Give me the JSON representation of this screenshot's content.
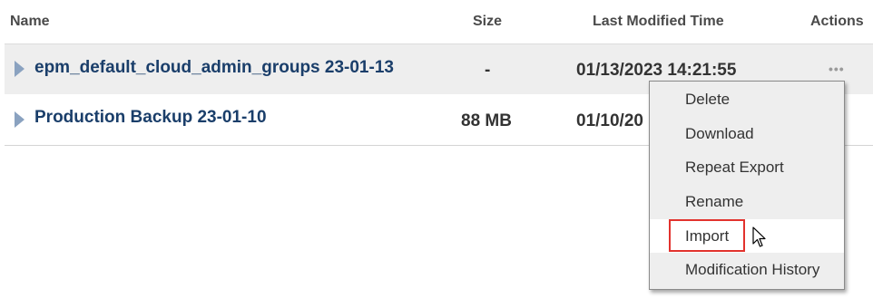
{
  "table": {
    "headers": {
      "name": "Name",
      "size": "Size",
      "modified": "Last Modified Time",
      "actions": "Actions"
    },
    "rows": [
      {
        "name": "epm_default_cloud_admin_groups 23-01-13",
        "size": "-",
        "modified": "01/13/2023 14:21:55",
        "actions_icon": "more-horizontal-icon"
      },
      {
        "name": "Production Backup 23-01-10",
        "size": "88 MB",
        "modified": "01/10/20",
        "actions_icon": "more-horizontal-icon"
      }
    ]
  },
  "context_menu": {
    "items": [
      "Delete",
      "Download",
      "Repeat Export",
      "Rename",
      "Import",
      "Modification History"
    ],
    "highlighted": "Import"
  },
  "icons": {
    "expander": "expand-triangle-icon",
    "cursor": "mouse-pointer-icon"
  },
  "colors": {
    "row_highlight": "#eeeeee",
    "link_text": "#1a3e6a",
    "highlight_box": "#e2322d",
    "expander": "#8aa2c0"
  }
}
